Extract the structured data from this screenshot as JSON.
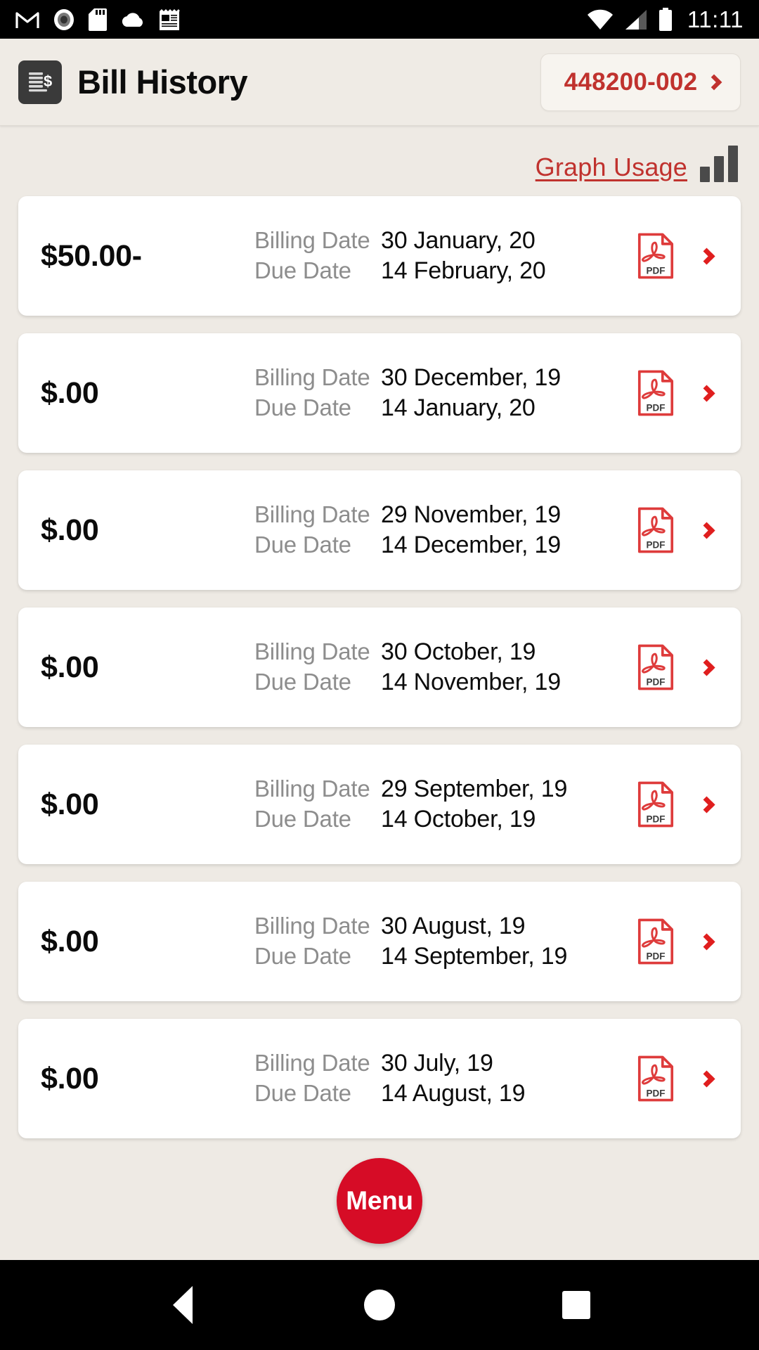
{
  "status_bar": {
    "time": "11:11",
    "left_icons": [
      "gmail-icon",
      "record-icon",
      "sd-card-icon",
      "cloud-icon",
      "news-icon"
    ],
    "right_icons": [
      "wifi-icon",
      "cellular-signal-icon",
      "battery-icon"
    ]
  },
  "header": {
    "icon": "bill-document-icon",
    "title": "Bill History",
    "account_number": "448200-002",
    "account_chevron": "chevron-right-icon"
  },
  "toolbar": {
    "graph_usage_label": "Graph Usage",
    "graph_icon": "bar-chart-icon"
  },
  "colors": {
    "accent_red": "#C0322E",
    "chevron_red": "#E01E1E",
    "fab_red": "#D60C26",
    "background": "#EEEAE4",
    "card": "#FFFFFF",
    "label_gray": "#8D8D8D",
    "icon_dark": "#3A3A3A"
  },
  "labels": {
    "billing_date": "Billing Date",
    "due_date": "Due Date",
    "pdf_icon": "pdf-file-icon",
    "row_chevron": "chevron-right-icon"
  },
  "bills": [
    {
      "amount": "$50.00-",
      "billing_date": "30 January, 20",
      "due_date": "14 February, 20"
    },
    {
      "amount": "$.00",
      "billing_date": "30 December, 19",
      "due_date": "14 January, 20"
    },
    {
      "amount": "$.00",
      "billing_date": "29 November, 19",
      "due_date": "14 December, 19"
    },
    {
      "amount": "$.00",
      "billing_date": "30 October, 19",
      "due_date": "14 November, 19"
    },
    {
      "amount": "$.00",
      "billing_date": "29 September, 19",
      "due_date": "14 October, 19"
    },
    {
      "amount": "$.00",
      "billing_date": "30 August, 19",
      "due_date": "14 September, 19"
    },
    {
      "amount": "$.00",
      "billing_date": "30 July, 19",
      "due_date": "14 August, 19"
    }
  ],
  "fab": {
    "label": "Menu"
  },
  "nav_bar": {
    "back": "back-triangle-icon",
    "home": "home-circle-icon",
    "recents": "recents-square-icon"
  }
}
